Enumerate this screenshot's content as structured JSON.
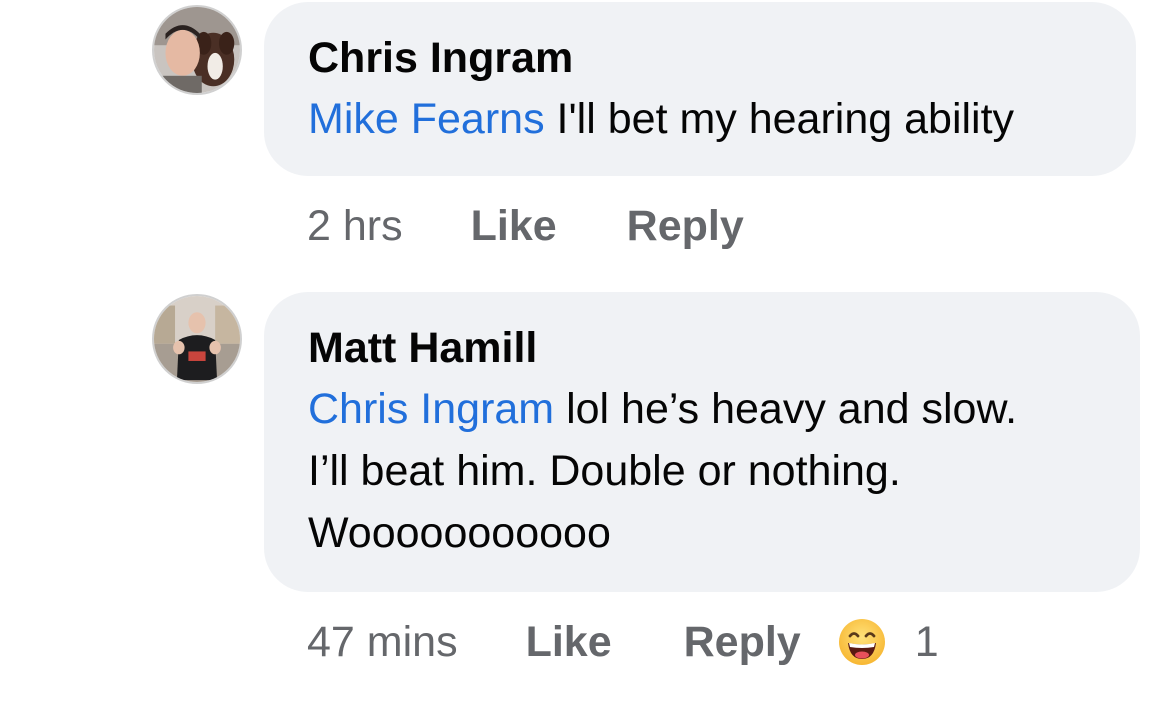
{
  "comments": [
    {
      "author": "Chris Ingram",
      "mention": "Mike Fearns",
      "text": " I'll bet my hearing ability",
      "time": "2 hrs",
      "like_label": "Like",
      "reply_label": "Reply",
      "avatar_icon": "profile-photo-man-with-dog"
    },
    {
      "author": "Matt Hamill",
      "mention": "Chris Ingram",
      "text_lines": [
        " lol he’s heavy and slow.",
        "I’ll beat him. Double or nothing.",
        "Wooooooooooo"
      ],
      "time": "47 mins",
      "like_label": "Like",
      "reply_label": "Reply",
      "reaction_icon": "grinning-face-emoji",
      "reaction_count": "1",
      "avatar_icon": "profile-photo-man-in-gym"
    }
  ],
  "colors": {
    "mention": "#216fdb",
    "bubble": "#f0f2f5",
    "meta": "#65676b",
    "text": "#050505"
  }
}
